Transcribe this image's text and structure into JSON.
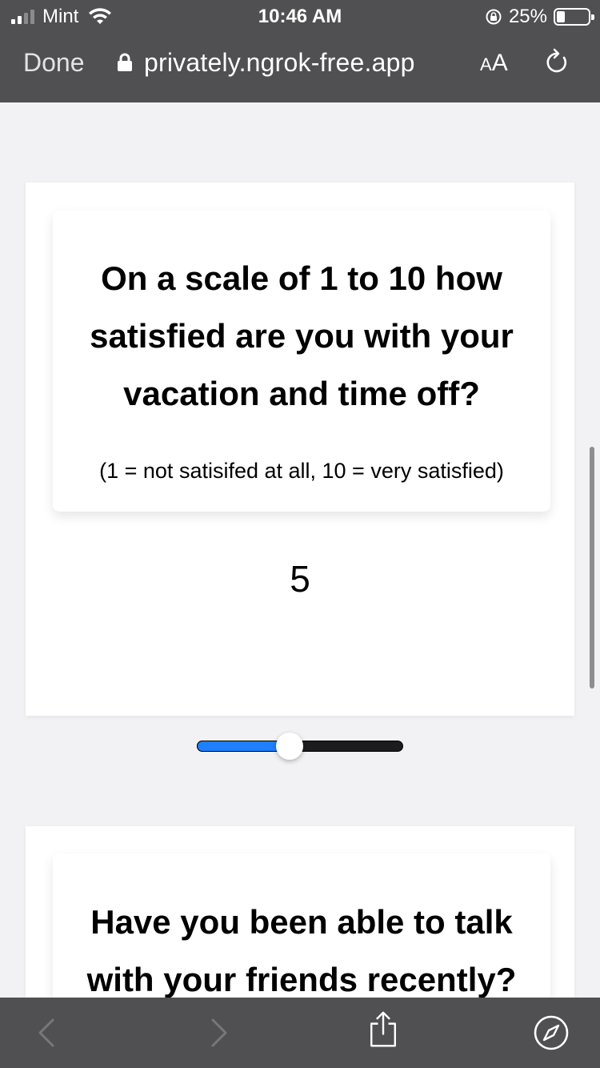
{
  "status_bar": {
    "carrier": "Mint",
    "time": "10:46 AM",
    "battery_percent_text": "25%",
    "battery_level": 0.25,
    "icons": [
      "signal-icon",
      "wifi-icon",
      "rotation-lock-icon",
      "battery-icon"
    ]
  },
  "browser": {
    "done_label": "Done",
    "url": "privately.ngrok-free.app",
    "reader_label_small": "A",
    "reader_label_large": "A",
    "icons": [
      "padlock-icon",
      "reload-icon"
    ]
  },
  "questions": [
    {
      "title": "On a scale of 1 to 10 how satisfied are you with your vacation and time off?",
      "hint": "(1 = not satisifed at all, 10 = very satisfied)",
      "slider": {
        "min": 1,
        "max": 10,
        "value": 5,
        "value_label": "5"
      }
    },
    {
      "title": "Have you been able to talk with your friends recently?"
    }
  ],
  "toolbar": {
    "icons": [
      "back-icon",
      "forward-icon",
      "share-icon",
      "safari-compass-icon"
    ]
  },
  "colors": {
    "chrome": "#505052",
    "accent": "#1f7fff",
    "page_bg": "#f2f2f4"
  }
}
